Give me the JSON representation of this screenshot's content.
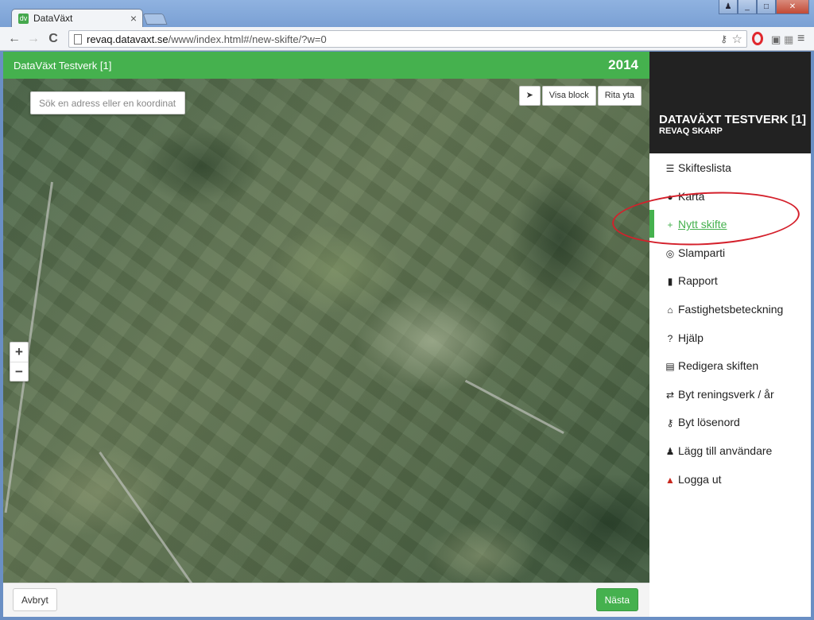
{
  "browser": {
    "tab_title": "DataVäxt",
    "tab_close": "×",
    "favicon": "dv",
    "url_domain": "revaq.datavaxt.se",
    "url_path": "/www/index.html#/new-skifte/?w=0",
    "back_icon": "←",
    "forward_icon": "→",
    "reload_icon": "C",
    "key_icon": "⚷",
    "star_icon": "☆",
    "menu_icon": "≡",
    "win_min": "_",
    "win_max": "□",
    "win_close": "✕",
    "win_user": "♟"
  },
  "header": {
    "title": "DataVäxt Testverk [1]",
    "year": "2014"
  },
  "map": {
    "search_placeholder": "Sök en adress eller en koordinat",
    "locate_icon": "➤",
    "show_block_label": "Visa block",
    "draw_area_label": "Rita yta",
    "zoom_in": "+",
    "zoom_out": "−"
  },
  "footer": {
    "cancel_label": "Avbryt",
    "next_label": "Nästa"
  },
  "sidebar": {
    "title": "DATAVÄXT TESTVERK [1]",
    "subtitle": "REVAQ SKARP",
    "items": [
      {
        "icon": "☰",
        "label": "Skifteslista"
      },
      {
        "icon": "●",
        "label": "Karta"
      },
      {
        "icon": "+",
        "label": "Nytt skifte"
      },
      {
        "icon": "◎",
        "label": "Slamparti"
      },
      {
        "icon": "▮",
        "label": "Rapport"
      },
      {
        "icon": "⌂",
        "label": "Fastighetsbeteckning"
      },
      {
        "icon": "?",
        "label": "Hjälp"
      },
      {
        "icon": "▤",
        "label": "Redigera skiften"
      },
      {
        "icon": "⇄",
        "label": "Byt reningsverk / år"
      },
      {
        "icon": "⚷",
        "label": "Byt lösenord"
      },
      {
        "icon": "♟",
        "label": "Lägg till användare"
      },
      {
        "icon": "▲",
        "label": "Logga ut"
      }
    ],
    "active_item": "Nytt skifte"
  },
  "colors": {
    "brand_green": "#45b14e",
    "sidebar_header": "#222222",
    "annotation_red": "#d4202b"
  }
}
